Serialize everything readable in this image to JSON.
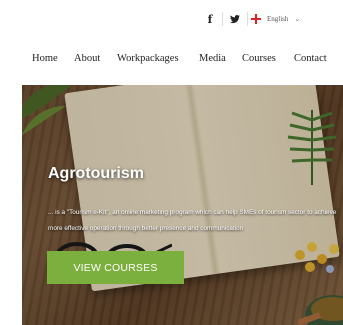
{
  "header": {
    "social": [
      {
        "icon": "facebook-icon",
        "glyph": "f"
      },
      {
        "icon": "twitter-icon",
        "glyph": "🐦"
      }
    ],
    "language": {
      "label": "English",
      "chevron": "⌄"
    }
  },
  "nav": {
    "items": [
      "Home",
      "About",
      "Workpackages",
      "Media",
      "Courses",
      "Contact"
    ]
  },
  "hero": {
    "title": "Agrotourism",
    "text": "... is a \"Tourism e-Kit\", an online marketing program which can help SMEs of tourism sector to achieve more effective operation through better presence and communication",
    "cta_label": "VIEW COURSES",
    "accent_color": "#7cb03e"
  }
}
